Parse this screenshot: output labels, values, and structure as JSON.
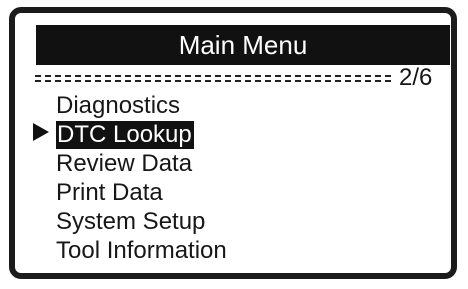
{
  "screen": {
    "title": "Main Menu",
    "page_indicator": "2/6"
  },
  "menu": {
    "selected_index": 1,
    "items": [
      {
        "label": "Diagnostics"
      },
      {
        "label": "DTC Lookup"
      },
      {
        "label": "Review Data"
      },
      {
        "label": "Print Data"
      },
      {
        "label": "System Setup"
      },
      {
        "label": "Tool Information"
      }
    ]
  },
  "icons": {
    "selection_cursor": "right-triangle-icon"
  },
  "colors": {
    "screen_background": "#ffffff",
    "title_background": "#111111",
    "title_text": "#ffffff",
    "menu_text": "#171717",
    "selected_background": "#111111",
    "selected_text": "#ffffff"
  }
}
